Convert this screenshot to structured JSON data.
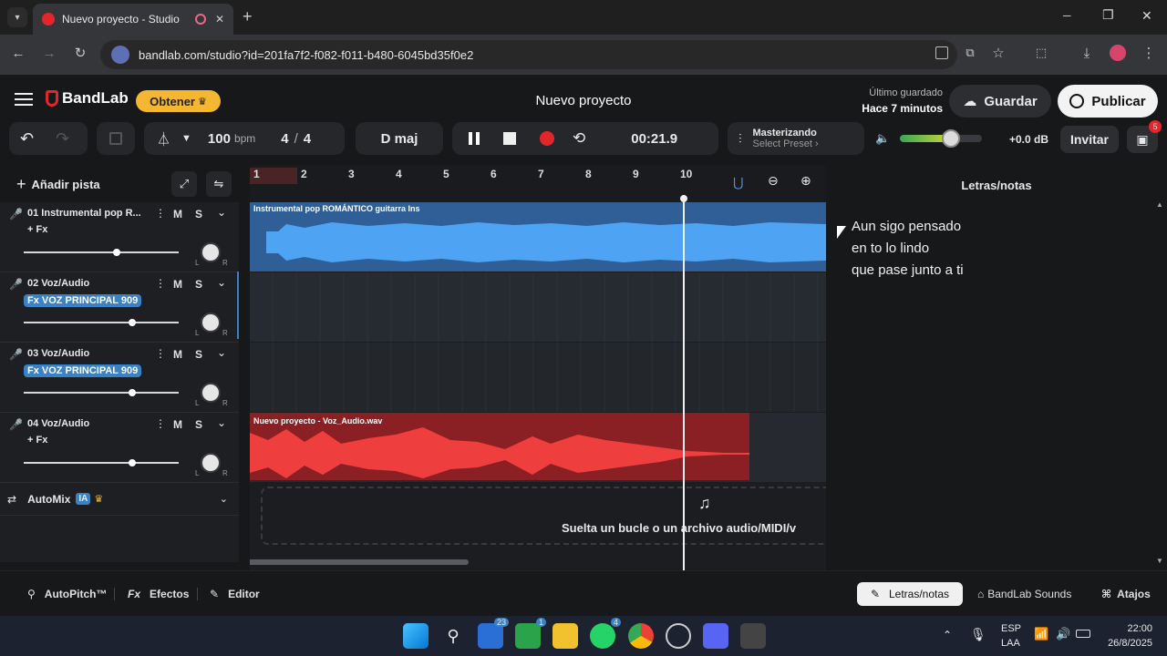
{
  "browser": {
    "tab_title": "Nuevo proyecto - Studio",
    "new_tab": "+",
    "url": "bandlab.com/studio?id=201fa7f2-f082-f011-b480-6045bd35f0e2",
    "win_min": "─",
    "win_max": "❐",
    "win_close": "✕"
  },
  "app": {
    "logo": "BandLab",
    "obtener": "Obtener",
    "project_title": "Nuevo proyecto",
    "saved_label": "Último guardado",
    "saved_time": "Hace 7 minutos",
    "save_btn": "Guardar",
    "publish_btn": "Publicar",
    "accent": "#f5b731",
    "record_color": "#e3262b"
  },
  "transport": {
    "bpm_value": "100",
    "bpm_unit": "bpm",
    "time_sig_num": "4",
    "time_sig_sep": "/",
    "time_sig_den": "4",
    "key": "D maj",
    "time": "00:21.9",
    "mastering": "Masterizando",
    "preset": "Select Preset ›",
    "volume_db": "+0.0 dB",
    "volume_level": 0.62,
    "invite": "Invitar",
    "gift_badge": "5"
  },
  "tracks": {
    "add_track": "Añadir pista",
    "mute": "M",
    "solo": "S",
    "items": [
      {
        "name": "01  Instrumental pop R...",
        "fx": "+ Fx",
        "fx_active": false,
        "vol": 0.6
      },
      {
        "name": "02  Voz/Audio",
        "fx": "Fx VOZ PRINCIPAL 909",
        "fx_active": true,
        "vol": 0.7
      },
      {
        "name": "03  Voz/Audio",
        "fx": "Fx VOZ PRINCIPAL 909",
        "fx_active": true,
        "vol": 0.7
      },
      {
        "name": "04  Voz/Audio",
        "fx": "+ Fx",
        "fx_active": false,
        "vol": 0.7
      }
    ],
    "automix": "AutoMix",
    "ia": "IA"
  },
  "ruler": [
    "1",
    "2",
    "3",
    "4",
    "5",
    "6",
    "7",
    "8",
    "9",
    "10"
  ],
  "clips": {
    "clip1": "Instrumental pop ROMÁNTICO guitarra  Ins",
    "clip4": "Nuevo proyecto - Voz_Audio.wav",
    "drop_hint": "Suelta un bucle o un archivo audio/MIDI/v"
  },
  "notes": {
    "title": "Letras/notas",
    "lines": [
      "Aun sigo pensado",
      "en to lo lindo",
      "que pase junto a ti"
    ]
  },
  "footer": {
    "autopitch": "AutoPitch™",
    "effects": "Efectos",
    "editor": "Editor",
    "letras": "Letras/notas",
    "sounds": "BandLab Sounds",
    "atajos": "Atajos"
  },
  "taskbar": {
    "lang1": "ESP",
    "lang2": "LAA",
    "clock": "22:00",
    "date": "26/8/2025",
    "badge_mail": "23",
    "badge_xbox": "1",
    "badge_wa": "4"
  }
}
